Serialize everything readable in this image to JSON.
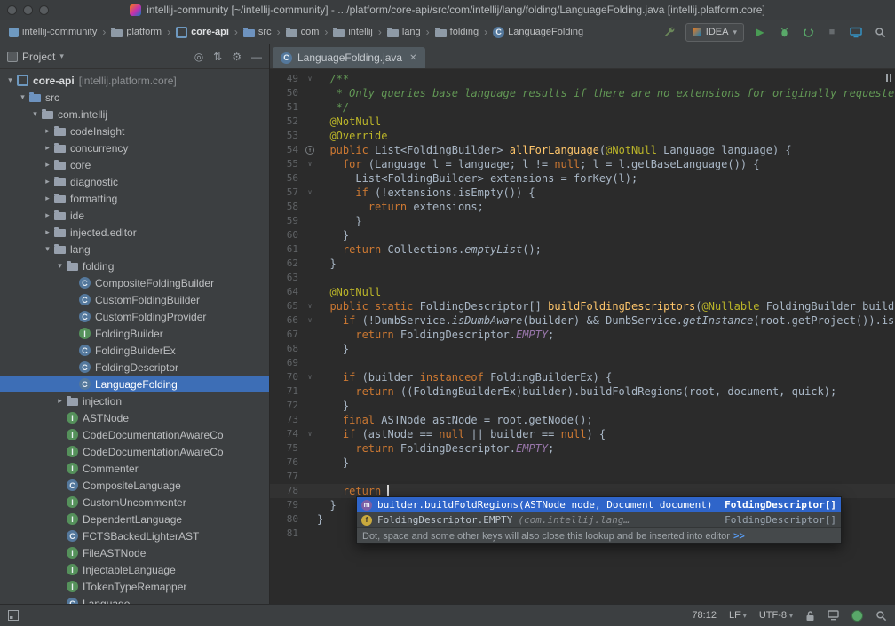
{
  "titlebar": {
    "title": "intellij-community [~/intellij-community] - .../platform/core-api/src/com/intellij/lang/folding/LanguageFolding.java [intellij.platform.core]"
  },
  "navbar": {
    "separator": "›",
    "run_config": "IDEA",
    "breadcrumbs": [
      {
        "label": "intellij-community",
        "icon": "project"
      },
      {
        "label": "platform",
        "icon": "folder"
      },
      {
        "label": "core-api",
        "icon": "module",
        "bold": true
      },
      {
        "label": "src",
        "icon": "folder-src"
      },
      {
        "label": "com",
        "icon": "folder"
      },
      {
        "label": "intellij",
        "icon": "folder"
      },
      {
        "label": "lang",
        "icon": "folder"
      },
      {
        "label": "folding",
        "icon": "folder"
      },
      {
        "label": "LanguageFolding",
        "icon": "class"
      }
    ]
  },
  "project_panel": {
    "title": "Project",
    "tree": [
      {
        "indent": 0,
        "arrow": "down",
        "icon": "module",
        "label": "core-api",
        "suffix": "[intellij.platform.core]"
      },
      {
        "indent": 1,
        "arrow": "down",
        "icon": "folder-src",
        "label": "src"
      },
      {
        "indent": 2,
        "arrow": "down",
        "icon": "package",
        "label": "com.intellij"
      },
      {
        "indent": 3,
        "arrow": "right",
        "icon": "package",
        "label": "codeInsight"
      },
      {
        "indent": 3,
        "arrow": "right",
        "icon": "package",
        "label": "concurrency"
      },
      {
        "indent": 3,
        "arrow": "right",
        "icon": "package",
        "label": "core"
      },
      {
        "indent": 3,
        "arrow": "right",
        "icon": "package",
        "label": "diagnostic"
      },
      {
        "indent": 3,
        "arrow": "right",
        "icon": "package",
        "label": "formatting"
      },
      {
        "indent": 3,
        "arrow": "right",
        "icon": "package",
        "label": "ide"
      },
      {
        "indent": 3,
        "arrow": "right",
        "icon": "package",
        "label": "injected.editor"
      },
      {
        "indent": 3,
        "arrow": "down",
        "icon": "package",
        "label": "lang"
      },
      {
        "indent": 4,
        "arrow": "down",
        "icon": "package",
        "label": "folding"
      },
      {
        "indent": 5,
        "arrow": "none",
        "icon": "class",
        "label": "CompositeFoldingBuilder"
      },
      {
        "indent": 5,
        "arrow": "none",
        "icon": "class",
        "label": "CustomFoldingBuilder"
      },
      {
        "indent": 5,
        "arrow": "none",
        "icon": "class",
        "label": "CustomFoldingProvider"
      },
      {
        "indent": 5,
        "arrow": "none",
        "icon": "interface",
        "label": "FoldingBuilder"
      },
      {
        "indent": 5,
        "arrow": "none",
        "icon": "class",
        "label": "FoldingBuilderEx"
      },
      {
        "indent": 5,
        "arrow": "none",
        "icon": "class",
        "label": "FoldingDescriptor"
      },
      {
        "indent": 5,
        "arrow": "none",
        "icon": "class",
        "label": "LanguageFolding",
        "selected": true
      },
      {
        "indent": 4,
        "arrow": "right",
        "icon": "package",
        "label": "injection"
      },
      {
        "indent": 4,
        "arrow": "none",
        "icon": "interface",
        "label": "ASTNode"
      },
      {
        "indent": 4,
        "arrow": "none",
        "icon": "interface",
        "label": "CodeDocumentationAwareCo"
      },
      {
        "indent": 4,
        "arrow": "none",
        "icon": "interface",
        "label": "CodeDocumentationAwareCo"
      },
      {
        "indent": 4,
        "arrow": "none",
        "icon": "interface",
        "label": "Commenter"
      },
      {
        "indent": 4,
        "arrow": "none",
        "icon": "class",
        "label": "CompositeLanguage"
      },
      {
        "indent": 4,
        "arrow": "none",
        "icon": "interface",
        "label": "CustomUncommenter"
      },
      {
        "indent": 4,
        "arrow": "none",
        "icon": "interface",
        "label": "DependentLanguage"
      },
      {
        "indent": 4,
        "arrow": "none",
        "icon": "class",
        "label": "FCTSBackedLighterAST"
      },
      {
        "indent": 4,
        "arrow": "none",
        "icon": "interface",
        "label": "FileASTNode"
      },
      {
        "indent": 4,
        "arrow": "none",
        "icon": "interface",
        "label": "InjectableLanguage"
      },
      {
        "indent": 4,
        "arrow": "none",
        "icon": "interface",
        "label": "ITokenTypeRemapper"
      },
      {
        "indent": 4,
        "arrow": "none",
        "icon": "class",
        "label": "Language"
      }
    ]
  },
  "editor": {
    "tab_label": "LanguageFolding.java",
    "first_line": 49,
    "caret_line": 78,
    "override_icon_line": 54,
    "fold_lines": [
      49,
      55,
      57,
      65,
      66,
      70,
      74
    ],
    "lines": [
      [
        [
          "c",
          "  /**"
        ]
      ],
      [
        [
          "c",
          "   * Only queries base language results if there are no extensions for originally requested "
        ]
      ],
      [
        [
          "c",
          "   */"
        ]
      ],
      [
        [
          "a",
          "  @NotNull"
        ]
      ],
      [
        [
          "a",
          "  @Override"
        ]
      ],
      [
        [
          "k",
          "  public "
        ],
        [
          "t",
          "List<FoldingBuilder> "
        ],
        [
          "m",
          "allForLanguage"
        ],
        [
          "t",
          "("
        ],
        [
          "a",
          "@NotNull"
        ],
        [
          "t",
          " Language language) {"
        ]
      ],
      [
        [
          "k",
          "    for "
        ],
        [
          "t",
          "(Language l = language; l != "
        ],
        [
          "k",
          "null"
        ],
        [
          "t",
          "; l = l.getBaseLanguage()) {"
        ]
      ],
      [
        [
          "t",
          "      List<FoldingBuilder> extensions = forKey(l);"
        ]
      ],
      [
        [
          "k",
          "      if "
        ],
        [
          "t",
          "(!extensions.isEmpty()) {"
        ]
      ],
      [
        [
          "k",
          "        return "
        ],
        [
          "t",
          "extensions;"
        ]
      ],
      [
        [
          "t",
          "      }"
        ]
      ],
      [
        [
          "t",
          "    }"
        ]
      ],
      [
        [
          "k",
          "    return "
        ],
        [
          "t",
          "Collections."
        ],
        [
          "sm",
          "emptyList"
        ],
        [
          "t",
          "();"
        ]
      ],
      [
        [
          "t",
          "  }"
        ]
      ],
      [],
      [
        [
          "a",
          "  @NotNull"
        ]
      ],
      [
        [
          "k",
          "  public static "
        ],
        [
          "t",
          "FoldingDescriptor[] "
        ],
        [
          "m",
          "buildFoldingDescriptors"
        ],
        [
          "t",
          "("
        ],
        [
          "a",
          "@Nullable"
        ],
        [
          "t",
          " FoldingBuilder builder"
        ]
      ],
      [
        [
          "k",
          "    if "
        ],
        [
          "t",
          "(!DumbService."
        ],
        [
          "sm",
          "isDumbAware"
        ],
        [
          "t",
          "(builder) && DumbService."
        ],
        [
          "sm",
          "getInstance"
        ],
        [
          "t",
          "(root.getProject()).isDum"
        ]
      ],
      [
        [
          "k",
          "      return "
        ],
        [
          "t",
          "FoldingDescriptor."
        ],
        [
          "f",
          "EMPTY"
        ],
        [
          "t",
          ";"
        ]
      ],
      [
        [
          "t",
          "    }"
        ]
      ],
      [],
      [
        [
          "k",
          "    if "
        ],
        [
          "t",
          "(builder "
        ],
        [
          "k",
          "instanceof"
        ],
        [
          "t",
          " FoldingBuilderEx) {"
        ]
      ],
      [
        [
          "k",
          "      return "
        ],
        [
          "t",
          "((FoldingBuilderEx)builder).buildFoldRegions(root, document, quick);"
        ]
      ],
      [
        [
          "t",
          "    }"
        ]
      ],
      [
        [
          "k",
          "    final "
        ],
        [
          "t",
          "ASTNode astNode = root.getNode();"
        ]
      ],
      [
        [
          "k",
          "    if "
        ],
        [
          "t",
          "(astNode == "
        ],
        [
          "k",
          "null"
        ],
        [
          "t",
          " || builder == "
        ],
        [
          "k",
          "null"
        ],
        [
          "t",
          ") {"
        ]
      ],
      [
        [
          "k",
          "      return "
        ],
        [
          "t",
          "FoldingDescriptor."
        ],
        [
          "f",
          "EMPTY"
        ],
        [
          "t",
          ";"
        ]
      ],
      [
        [
          "t",
          "    }"
        ]
      ],
      [],
      [
        [
          "k",
          "    return "
        ],
        [
          "cur",
          ""
        ]
      ],
      [
        [
          "t",
          "  }"
        ]
      ],
      [
        [
          "t",
          "}"
        ]
      ],
      []
    ]
  },
  "completion": {
    "items": [
      {
        "icon": "method",
        "label": "builder.buildFoldRegions(ASTNode node, Document document)",
        "type": "FoldingDescriptor[]",
        "selected": true
      },
      {
        "icon": "field",
        "label": "FoldingDescriptor.EMPTY ",
        "tail": "(com.intellij.lang…",
        "type": "FoldingDescriptor[]",
        "selected": false
      }
    ],
    "hint_text": "Dot, space and some other keys will also close this lookup and be inserted into editor",
    "hint_link": ">>"
  },
  "statusbar": {
    "position": "78:12",
    "line_separator": "LF",
    "encoding": "UTF-8"
  },
  "colors": {
    "panel_bg": "#3c3f41",
    "editor_bg": "#2b2b2b",
    "tree_selection": "#3d6eb6",
    "completion_selection": "#2f65ca",
    "keyword": "#cc7832",
    "comment": "#629755",
    "annotation": "#bbb529",
    "method": "#ffc66b",
    "constant": "#9876aa",
    "text": "#a9b7c6",
    "line_number": "#606366",
    "run_green": "#499c54",
    "link_blue": "#589df6"
  }
}
